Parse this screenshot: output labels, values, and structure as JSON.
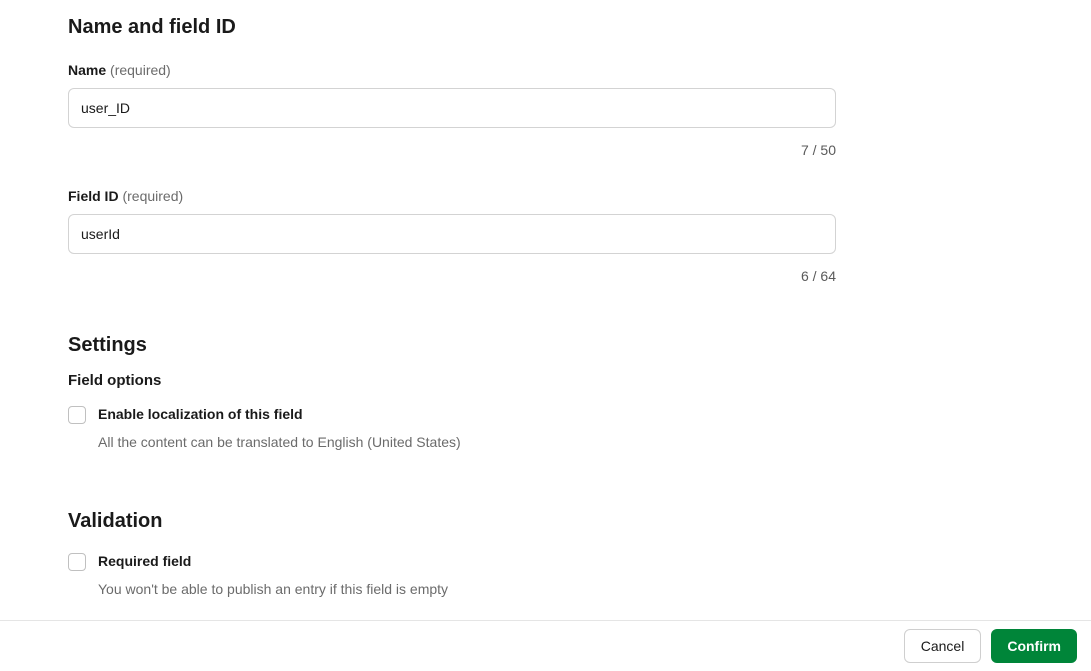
{
  "sections": {
    "nameAndId": {
      "title": "Name and field ID",
      "name": {
        "label": "Name",
        "required": "(required)",
        "value": "user_ID",
        "count": "7 / 50"
      },
      "fieldId": {
        "label": "Field ID",
        "required": "(required)",
        "value": "userId",
        "count": "6 / 64"
      }
    },
    "settings": {
      "title": "Settings",
      "fieldOptions": {
        "heading": "Field options",
        "localization": {
          "label": "Enable localization of this field",
          "desc": "All the content can be translated to English (United States)"
        }
      }
    },
    "validation": {
      "title": "Validation",
      "required": {
        "label": "Required field",
        "desc": "You won't be able to publish an entry if this field is empty"
      }
    }
  },
  "footer": {
    "cancel": "Cancel",
    "confirm": "Confirm"
  }
}
